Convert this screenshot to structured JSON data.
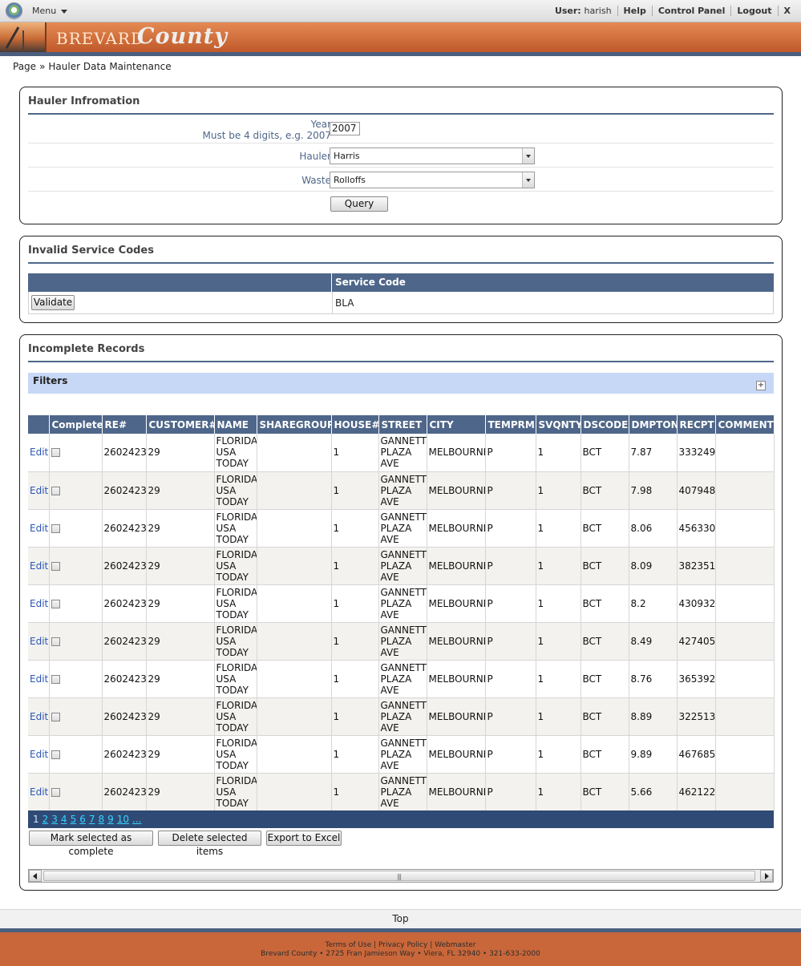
{
  "topbar": {
    "menu_label": "Menu",
    "user_label": "User:",
    "user_name": "harish",
    "help": "Help",
    "control_panel": "Control Panel",
    "logout": "Logout",
    "close": "X"
  },
  "banner": {
    "brand": "BREVARD",
    "script": "County"
  },
  "breadcrumb": {
    "root": "Page",
    "separator": "»",
    "current": "Hauler Data Maintenance"
  },
  "hauler_panel": {
    "title": "Hauler Infromation",
    "year_label": "Year",
    "year_hint": "Must be 4 digits, e.g. 2007",
    "year_value": "2007",
    "hauler_label": "Hauler",
    "hauler_value": "Harris",
    "waste_label": "Waste",
    "waste_value": "Rolloffs",
    "query_button": "Query"
  },
  "invalid_panel": {
    "title": "Invalid Service Codes",
    "column_header": "Service Code",
    "validate_button": "Validate",
    "service_code": "BLA"
  },
  "records_panel": {
    "title": "Incomplete Records",
    "filters_label": "Filters",
    "filters_toggle": "+",
    "columns": [
      "",
      "Complete",
      "RE#",
      "CUSTOMER#",
      "NAME",
      "SHAREGROUP",
      "HOUSE#",
      "STREET",
      "CITY",
      "TEMPRM",
      "SVQNTY",
      "DSCODE",
      "DMPTON",
      "RECPT",
      "COMMENTS"
    ],
    "edit_label": "Edit",
    "rows": [
      {
        "re": "2602423",
        "customer": "29",
        "name": "FLORIDA USA TODAY",
        "sharegroup": "",
        "house": "1",
        "street": "GANNETT PLAZA AVE",
        "city": "MELBOURNE",
        "temprm": "P",
        "svqnty": "1",
        "dscode": "BCT",
        "dmpton": "7.87",
        "recpt": "333249",
        "comments": ""
      },
      {
        "re": "2602423",
        "customer": "29",
        "name": "FLORIDA USA TODAY",
        "sharegroup": "",
        "house": "1",
        "street": "GANNETT PLAZA AVE",
        "city": "MELBOURNE",
        "temprm": "P",
        "svqnty": "1",
        "dscode": "BCT",
        "dmpton": "7.98",
        "recpt": "407948",
        "comments": ""
      },
      {
        "re": "2602423",
        "customer": "29",
        "name": "FLORIDA USA TODAY",
        "sharegroup": "",
        "house": "1",
        "street": "GANNETT PLAZA AVE",
        "city": "MELBOURNE",
        "temprm": "P",
        "svqnty": "1",
        "dscode": "BCT",
        "dmpton": "8.06",
        "recpt": "456330",
        "comments": ""
      },
      {
        "re": "2602423",
        "customer": "29",
        "name": "FLORIDA USA TODAY",
        "sharegroup": "",
        "house": "1",
        "street": "GANNETT PLAZA AVE",
        "city": "MELBOURNE",
        "temprm": "P",
        "svqnty": "1",
        "dscode": "BCT",
        "dmpton": "8.09",
        "recpt": "382351",
        "comments": ""
      },
      {
        "re": "2602423",
        "customer": "29",
        "name": "FLORIDA USA TODAY",
        "sharegroup": "",
        "house": "1",
        "street": "GANNETT PLAZA AVE",
        "city": "MELBOURNE",
        "temprm": "P",
        "svqnty": "1",
        "dscode": "BCT",
        "dmpton": "8.2",
        "recpt": "430932",
        "comments": ""
      },
      {
        "re": "2602423",
        "customer": "29",
        "name": "FLORIDA USA TODAY",
        "sharegroup": "",
        "house": "1",
        "street": "GANNETT PLAZA AVE",
        "city": "MELBOURNE",
        "temprm": "P",
        "svqnty": "1",
        "dscode": "BCT",
        "dmpton": "8.49",
        "recpt": "427405",
        "comments": ""
      },
      {
        "re": "2602423",
        "customer": "29",
        "name": "FLORIDA USA TODAY",
        "sharegroup": "",
        "house": "1",
        "street": "GANNETT PLAZA AVE",
        "city": "MELBOURNE",
        "temprm": "P",
        "svqnty": "1",
        "dscode": "BCT",
        "dmpton": "8.76",
        "recpt": "365392",
        "comments": ""
      },
      {
        "re": "2602423",
        "customer": "29",
        "name": "FLORIDA USA TODAY",
        "sharegroup": "",
        "house": "1",
        "street": "GANNETT PLAZA AVE",
        "city": "MELBOURNE",
        "temprm": "P",
        "svqnty": "1",
        "dscode": "BCT",
        "dmpton": "8.89",
        "recpt": "322513",
        "comments": ""
      },
      {
        "re": "2602423",
        "customer": "29",
        "name": "FLORIDA USA TODAY",
        "sharegroup": "",
        "house": "1",
        "street": "GANNETT PLAZA AVE",
        "city": "MELBOURNE",
        "temprm": "P",
        "svqnty": "1",
        "dscode": "BCT",
        "dmpton": "9.89",
        "recpt": "467685",
        "comments": ""
      },
      {
        "re": "2602423",
        "customer": "29",
        "name": "FLORIDA USA TODAY",
        "sharegroup": "",
        "house": "1",
        "street": "GANNETT PLAZA AVE",
        "city": "MELBOURNE",
        "temprm": "P",
        "svqnty": "1",
        "dscode": "BCT",
        "dmpton": "5.66",
        "recpt": "462122",
        "comments": ""
      }
    ],
    "pages": [
      "1",
      "2",
      "3",
      "4",
      "5",
      "6",
      "7",
      "8",
      "9",
      "10",
      "..."
    ],
    "mark_complete_button": "Mark selected as complete",
    "delete_button": "Delete selected items",
    "export_button": "Export to Excel"
  },
  "footer": {
    "top_link": "Top",
    "terms": "Terms of Use",
    "privacy": "Privacy Policy",
    "webmaster": "Webmaster",
    "address": "Brevard County • 2725 Fran Jamieson Way • Viera, FL 32940 • 321-633-2000"
  },
  "colors": {
    "header_blue": "#4e6689",
    "banner_orange": "#c9673a",
    "filters_blue": "#c7d8f6",
    "link_blue": "#2a56b5"
  },
  "icons": [
    "globe-logo-icon",
    "chevron-down-icon",
    "plus-icon",
    "scroll-left-icon",
    "scroll-right-icon"
  ]
}
